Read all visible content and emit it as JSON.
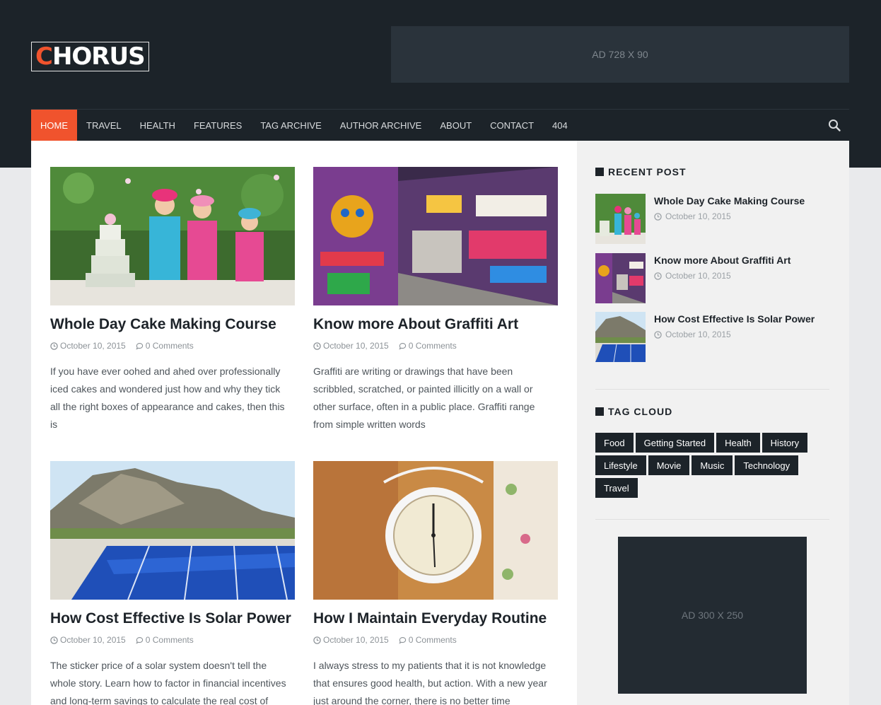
{
  "brand": {
    "logo_first": "C",
    "logo_rest": "HORUS"
  },
  "ads": {
    "top": "AD 728 X 90",
    "side": "AD 300 X 250"
  },
  "nav": {
    "items": [
      "Home",
      "Travel",
      "Health",
      "Features",
      "Tag Archive",
      "Author Archive",
      "About",
      "Contact",
      "404"
    ],
    "active": "Home"
  },
  "posts": [
    {
      "title": "Whole Day Cake Making Course",
      "date": "October 10, 2015",
      "comments": "0 Comments",
      "excerpt": "If you have ever oohed and ahed over professionally iced cakes and wondered just how and why they tick all the right boxes of appearance and cakes, then this is"
    },
    {
      "title": "Know more About Graffiti Art",
      "date": "October 10, 2015",
      "comments": "0 Comments",
      "excerpt": "Graffiti are writing or drawings that have been scribbled, scratched, or painted illicitly on a wall or other surface, often in a public place. Graffiti range from simple written words"
    },
    {
      "title": "How Cost Effective Is Solar Power",
      "date": "October 10, 2015",
      "comments": "0 Comments",
      "excerpt": "The sticker price of a solar system doesn't tell the whole story. Learn how to factor in financial incentives and long-term savings to calculate the real cost of"
    },
    {
      "title": "How I Maintain Everyday Routine",
      "date": "October 10, 2015",
      "comments": "0 Comments",
      "excerpt": "I always stress to my patients that it is not knowledge that ensures good health, but action. With a new year just around the corner, there is no better time"
    }
  ],
  "sidebar": {
    "recent_title": "RECENT POST",
    "recent": [
      {
        "title": "Whole Day Cake Making Course",
        "date": "October 10, 2015"
      },
      {
        "title": "Know more About Graffiti Art",
        "date": "October 10, 2015"
      },
      {
        "title": "How Cost Effective Is Solar Power",
        "date": "October 10, 2015"
      }
    ],
    "tag_title": "TAG CLOUD",
    "tags": [
      "Food",
      "Getting Started",
      "Health",
      "History",
      "Lifestyle",
      "Movie",
      "Music",
      "Technology",
      "Travel"
    ]
  },
  "colors": {
    "accent": "#f0532d",
    "dark": "#1c2329",
    "sidebar_bg": "#f1f1f1"
  },
  "icons": {
    "search": "search-icon",
    "clock": "clock-icon",
    "comment": "comment-icon"
  }
}
